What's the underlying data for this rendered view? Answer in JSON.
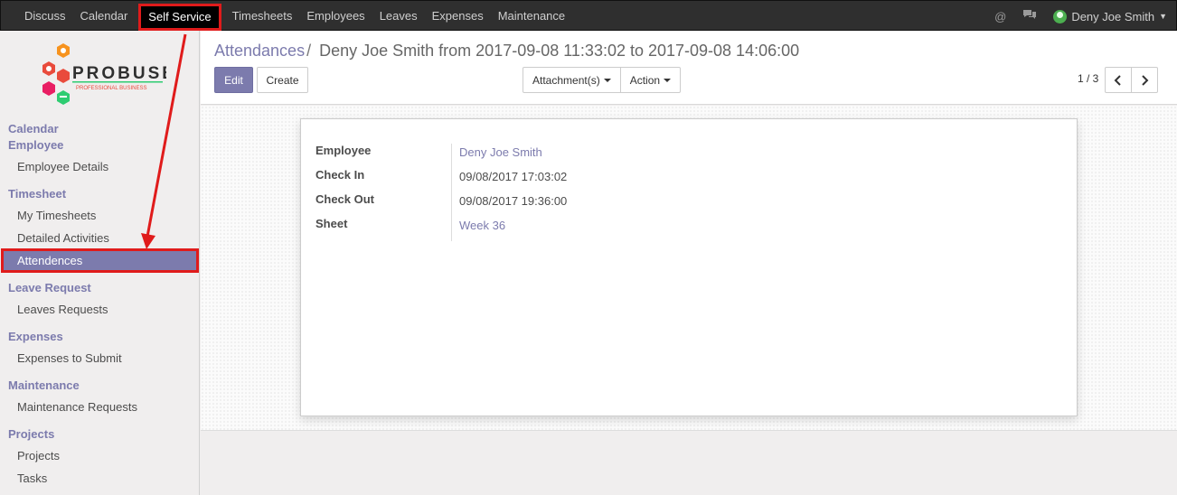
{
  "topbar": {
    "menu": [
      {
        "label": "Discuss",
        "name": "nav-discuss"
      },
      {
        "label": "Calendar",
        "name": "nav-calendar"
      },
      {
        "label": "Self Service",
        "name": "nav-self-service"
      },
      {
        "label": "Timesheets",
        "name": "nav-timesheets"
      },
      {
        "label": "Employees",
        "name": "nav-employees"
      },
      {
        "label": "Leaves",
        "name": "nav-leaves"
      },
      {
        "label": "Expenses",
        "name": "nav-expenses"
      },
      {
        "label": "Maintenance",
        "name": "nav-maintenance"
      }
    ],
    "active_index": 2,
    "icons": {
      "mention": "@",
      "chat": "chat-icon"
    },
    "user": "Deny Joe Smith"
  },
  "logo": {
    "brand": "PROBUSE",
    "tagline": "PROFESSIONAL BUSINESS"
  },
  "sidebar": {
    "calendar": "Calendar",
    "employee": "Employee",
    "employee_details": "Employee Details",
    "timesheet": "Timesheet",
    "my_timesheets": "My Timesheets",
    "detailed_activities": "Detailed Activities",
    "attendences": "Attendences",
    "leave_request": "Leave Request",
    "leaves_requests": "Leaves Requests",
    "expenses": "Expenses",
    "expenses_to_submit": "Expenses to Submit",
    "maintenance": "Maintenance",
    "maintenance_requests": "Maintenance Requests",
    "projects": "Projects",
    "projects_item": "Projects",
    "tasks": "Tasks"
  },
  "control": {
    "breadcrumb_parent": "Attendances",
    "breadcrumb_sep": "/",
    "breadcrumb_current": "Deny Joe Smith from 2017-09-08 11:33:02 to 2017-09-08 14:06:00",
    "edit": "Edit",
    "create": "Create",
    "attachments": "Attachment(s)",
    "action": "Action",
    "pager": "1 / 3"
  },
  "form": {
    "employee_label": "Employee",
    "employee_value": "Deny Joe Smith",
    "check_in_label": "Check In",
    "check_in_value": "09/08/2017 17:03:02",
    "check_out_label": "Check Out",
    "check_out_value": "09/08/2017 19:36:00",
    "sheet_label": "Sheet",
    "sheet_value": "Week 36"
  },
  "colors": {
    "accent": "#7c7bad",
    "highlight": "#e01b1b",
    "navbar": "#2f2f2f"
  }
}
